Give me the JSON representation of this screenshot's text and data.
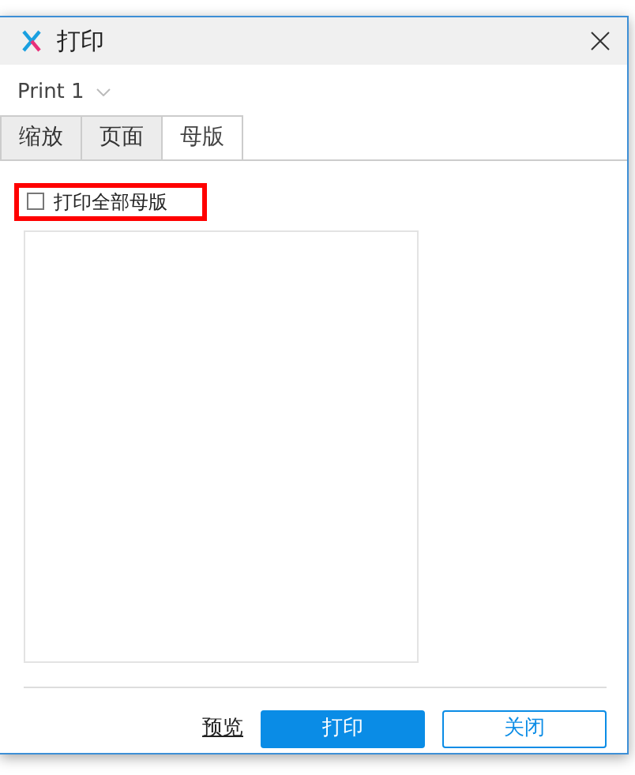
{
  "window": {
    "title": "打印"
  },
  "print_selector": {
    "value": "Print 1"
  },
  "tabs": [
    {
      "label": "缩放",
      "selected": false
    },
    {
      "label": "页面",
      "selected": false
    },
    {
      "label": "母版",
      "selected": true
    }
  ],
  "print_all_masters": {
    "label": "打印全部母版",
    "checked": false,
    "highlighted": true
  },
  "buttons": [
    {
      "kind": "link",
      "label": "预览"
    },
    {
      "kind": "primary",
      "label": "打印"
    },
    {
      "kind": "outline",
      "label": "关闭"
    }
  ]
}
